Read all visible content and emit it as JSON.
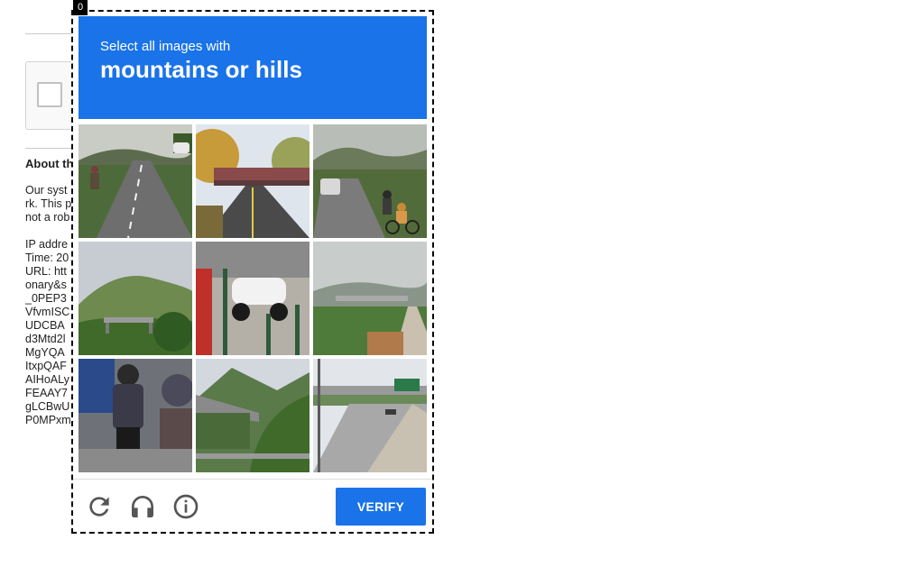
{
  "page": {
    "about_heading": "About th",
    "paragraph": [
      "Our syst",
      "rk. This p",
      "not a rob"
    ],
    "details": [
      "IP addre",
      "Time: 20",
      "URL: htt",
      "onary&s",
      "_0PEP3",
      "VfvmISC",
      "UDCBA",
      "d3Mtd2l",
      "MgYQA",
      "ItxpQAF",
      "AIHoALy",
      "FEAAY7",
      "gLCBwU",
      "P0MPxm"
    ]
  },
  "challenge": {
    "index_badge": "0",
    "instruction": "Select all images with",
    "target": "mountains or hills",
    "tiles": [
      {
        "id": "tile-1",
        "scene": "road-motorcycle"
      },
      {
        "id": "tile-2",
        "scene": "bridge-trees"
      },
      {
        "id": "tile-3",
        "scene": "road-cyclists"
      },
      {
        "id": "tile-4",
        "scene": "hill-bridge"
      },
      {
        "id": "tile-5",
        "scene": "scooter-sidewalk"
      },
      {
        "id": "tile-6",
        "scene": "valley-bridge"
      },
      {
        "id": "tile-7",
        "scene": "motorbike-riders"
      },
      {
        "id": "tile-8",
        "scene": "mountain-bridge"
      },
      {
        "id": "tile-9",
        "scene": "highway-overpass"
      }
    ],
    "verify_label": "VERIFY",
    "icons": [
      "reload-icon",
      "audio-icon",
      "info-icon"
    ],
    "accent_color": "#1a73e8"
  }
}
